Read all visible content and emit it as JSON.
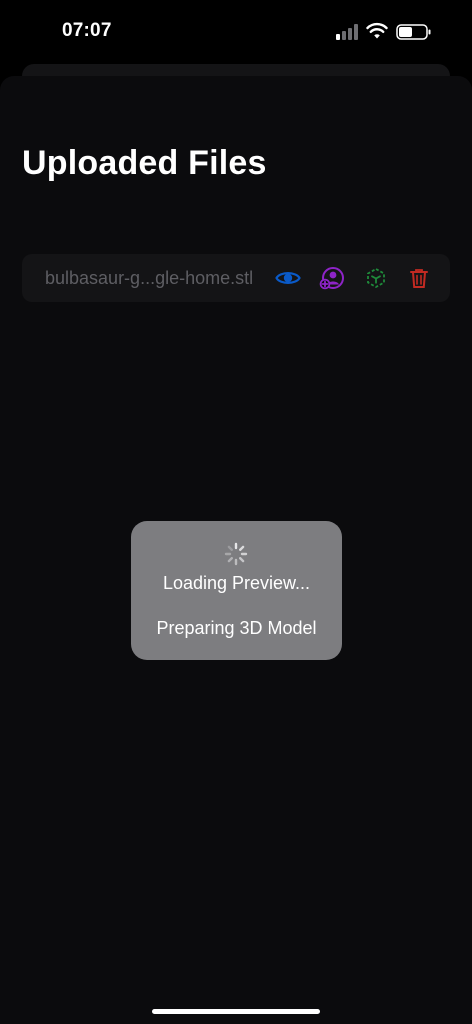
{
  "status_bar": {
    "time": "07:07",
    "icons": [
      "cellular-signal-icon",
      "wifi-icon",
      "battery-icon"
    ]
  },
  "page": {
    "title": "Uploaded Files"
  },
  "files": [
    {
      "name": "bulbasaur-g...gle-home.stl",
      "actions": [
        {
          "icon": "eye-icon",
          "color": "#0a5ac8"
        },
        {
          "icon": "person-add-icon",
          "color": "#8e24c8"
        },
        {
          "icon": "cube-icon",
          "color": "#1f8a3a"
        },
        {
          "icon": "trash-icon",
          "color": "#c22a22"
        }
      ]
    }
  ],
  "loading": {
    "title": "Loading Preview...",
    "subtitle": "Preparing 3D Model"
  },
  "colors": {
    "background": "#000000",
    "sheet": "#0b0b0d",
    "row": "#141416",
    "hud": "#7d7d80",
    "filename_text": "#5e5e63"
  }
}
